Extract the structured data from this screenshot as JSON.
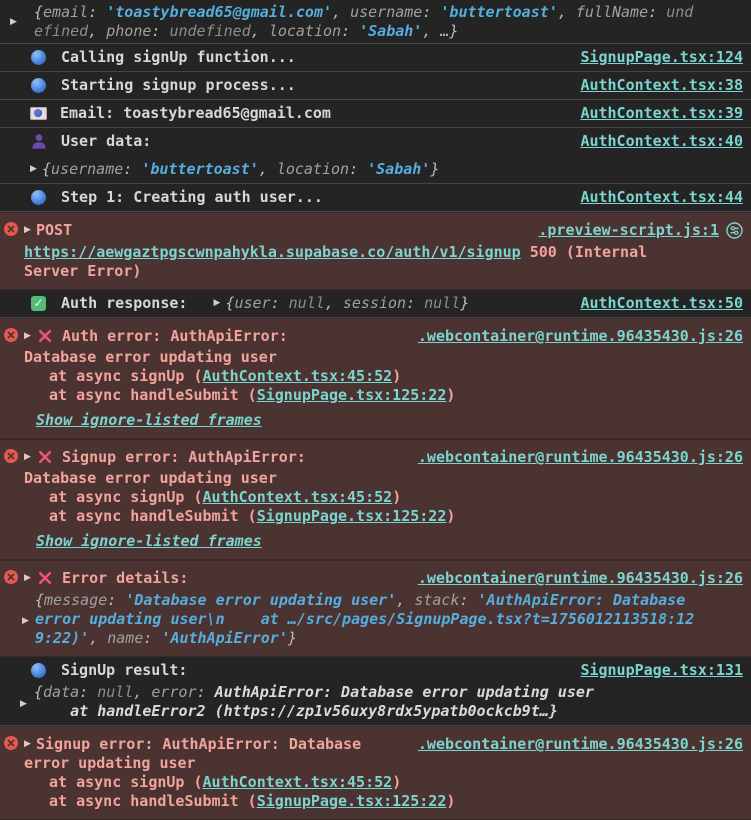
{
  "colors": {
    "background": "#242424",
    "error_background": "#4b3332",
    "error_text": "#f2a39c",
    "link_teal": "#7cd4ce",
    "string_value": "#55aedd",
    "log_text": "#d7d7d7",
    "error_badge_red": "#e5594e"
  },
  "console": {
    "rows": [
      {
        "name": "user-data-object-preview",
        "kind": "log",
        "expander": "▶",
        "lines": [
          {
            "parts": [
              {
                "t": "{",
                "s": "p"
              },
              {
                "t": "email",
                "s": "k"
              },
              {
                "t": ": ",
                "s": "p"
              },
              {
                "t": "'toastybread65@gmail.com'",
                "s": "str"
              },
              {
                "t": ", ",
                "s": "p"
              },
              {
                "t": "username",
                "s": "k"
              },
              {
                "t": ": ",
                "s": "p"
              },
              {
                "t": "'buttertoast'",
                "s": "str"
              },
              {
                "t": ", ",
                "s": "p"
              },
              {
                "t": "fullName",
                "s": "k"
              },
              {
                "t": ": ",
                "s": "p"
              },
              {
                "t": "und",
                "s": "und"
              }
            ]
          },
          {
            "parts": [
              {
                "t": "efined",
                "s": "und"
              },
              {
                "t": ", ",
                "s": "p"
              },
              {
                "t": "phone",
                "s": "k"
              },
              {
                "t": ": ",
                "s": "p"
              },
              {
                "t": "undefined",
                "s": "und"
              },
              {
                "t": ", ",
                "s": "p"
              },
              {
                "t": "location",
                "s": "k"
              },
              {
                "t": ": ",
                "s": "p"
              },
              {
                "t": "'Sabah'",
                "s": "str"
              },
              {
                "t": ", …}",
                "s": "p"
              }
            ]
          }
        ]
      },
      {
        "name": "calling-signup",
        "kind": "log",
        "icon": "blue-circle-icon",
        "message": "Calling signUp function...",
        "source": "SignupPage.tsx:124"
      },
      {
        "name": "starting-signup",
        "kind": "log",
        "icon": "blue-circle-icon",
        "message": "Starting signup process...",
        "source": "AuthContext.tsx:38"
      },
      {
        "name": "email-log",
        "kind": "log",
        "icon": "email-icon",
        "message": "Email: toastybread65@gmail.com",
        "source": "AuthContext.tsx:39"
      },
      {
        "name": "user-data-log",
        "kind": "log",
        "icon": "user-icon",
        "message": "User data:",
        "source": "AuthContext.tsx:40",
        "expander": "▶",
        "preview": [
          {
            "t": "{",
            "s": "p"
          },
          {
            "t": "username",
            "s": "k"
          },
          {
            "t": ": ",
            "s": "p"
          },
          {
            "t": "'buttertoast'",
            "s": "str"
          },
          {
            "t": ", ",
            "s": "p"
          },
          {
            "t": "location",
            "s": "k"
          },
          {
            "t": ": ",
            "s": "p"
          },
          {
            "t": "'Sabah'",
            "s": "str"
          },
          {
            "t": "}",
            "s": "p"
          }
        ]
      },
      {
        "name": "step1-creating-auth-user",
        "kind": "log",
        "icon": "blue-circle-icon",
        "message": "Step 1: Creating auth user...",
        "source": "AuthContext.tsx:44"
      },
      {
        "name": "post-500-network-error",
        "kind": "error",
        "expander": "▶",
        "title": "POST",
        "source": ".preview-script.js:1",
        "source_icon": "tune-icon",
        "lines": [
          {
            "parts": [
              {
                "t": "https://aewgaztpgscwnpahykla.supabase.co/auth/v1/signup",
                "s": "link"
              },
              {
                "t": " 500 (Internal",
                "s": "err"
              }
            ]
          },
          {
            "parts": [
              {
                "t": "Server Error)",
                "s": "err"
              }
            ]
          }
        ]
      },
      {
        "name": "auth-response",
        "kind": "log",
        "icon": "check-icon",
        "message": "Auth response:",
        "source": "AuthContext.tsx:50",
        "expander": "▶",
        "check_glyph": "✓",
        "preview": [
          {
            "t": "{",
            "s": "p"
          },
          {
            "t": "user",
            "s": "k"
          },
          {
            "t": ": ",
            "s": "p"
          },
          {
            "t": "null",
            "s": "und"
          },
          {
            "t": ", ",
            "s": "p"
          },
          {
            "t": "session",
            "s": "k"
          },
          {
            "t": ": ",
            "s": "p"
          },
          {
            "t": "null",
            "s": "und"
          },
          {
            "t": "}",
            "s": "p"
          }
        ]
      },
      {
        "name": "auth-error",
        "kind": "error",
        "expander": "▶",
        "xmark": "red-x-icon",
        "title": "Auth error: AuthApiError:",
        "source": ".webcontainer@runtime.96435430.js:26",
        "lines": [
          {
            "parts": [
              {
                "t": "Database error updating user",
                "s": "err"
              }
            ]
          },
          {
            "parts": [
              {
                "t": "at async signUp (",
                "s": "err"
              },
              {
                "t": "AuthContext.tsx:45:52",
                "s": "link"
              },
              {
                "t": ")",
                "s": "err"
              }
            ]
          },
          {
            "parts": [
              {
                "t": "at async handleSubmit (",
                "s": "err"
              },
              {
                "t": "SignupPage.tsx:125:22",
                "s": "link"
              },
              {
                "t": ")",
                "s": "err"
              }
            ]
          }
        ],
        "footer": "Show ignore-listed frames"
      },
      {
        "name": "signup-error",
        "kind": "error",
        "expander": "▶",
        "xmark": "red-x-icon",
        "title": "Signup error: AuthApiError:",
        "source": ".webcontainer@runtime.96435430.js:26",
        "lines": [
          {
            "parts": [
              {
                "t": "Database error updating user",
                "s": "err"
              }
            ]
          },
          {
            "parts": [
              {
                "t": "at async signUp (",
                "s": "err"
              },
              {
                "t": "AuthContext.tsx:45:52",
                "s": "link"
              },
              {
                "t": ")",
                "s": "err"
              }
            ]
          },
          {
            "parts": [
              {
                "t": "at async handleSubmit (",
                "s": "err"
              },
              {
                "t": "SignupPage.tsx:125:22",
                "s": "link"
              },
              {
                "t": ")",
                "s": "err"
              }
            ]
          }
        ],
        "footer": "Show ignore-listed frames"
      },
      {
        "name": "error-details",
        "kind": "error",
        "expander": "▶",
        "xmark": "red-x-icon",
        "title": "Error details:",
        "source": ".webcontainer@runtime.96435430.js:26",
        "preview_expander": "▶",
        "preview_lines": [
          {
            "parts": [
              {
                "t": "{",
                "s": "p"
              },
              {
                "t": "message",
                "s": "k"
              },
              {
                "t": ": ",
                "s": "p"
              },
              {
                "t": "'Database error updating user'",
                "s": "str"
              },
              {
                "t": ", ",
                "s": "p"
              },
              {
                "t": "stack",
                "s": "k"
              },
              {
                "t": ": ",
                "s": "p"
              },
              {
                "t": "'AuthApiError: Database",
                "s": "str"
              }
            ]
          },
          {
            "parts": [
              {
                "t": "error updating user\\n    at …/src/pages/SignupPage.tsx?t=1756012113518:12",
                "s": "str"
              }
            ]
          },
          {
            "parts": [
              {
                "t": "9:22)'",
                "s": "str"
              },
              {
                "t": ", ",
                "s": "p"
              },
              {
                "t": "name",
                "s": "k"
              },
              {
                "t": ": ",
                "s": "p"
              },
              {
                "t": "'AuthApiError'",
                "s": "str"
              },
              {
                "t": "}",
                "s": "p"
              }
            ]
          }
        ]
      },
      {
        "name": "signup-result",
        "kind": "log",
        "icon": "blue-circle-icon",
        "message": "SignUp result:",
        "source": "SignupPage.tsx:131",
        "expander": "▶",
        "preview_lines": [
          {
            "parts": [
              {
                "t": "{",
                "s": "p"
              },
              {
                "t": "data",
                "s": "k"
              },
              {
                "t": ": ",
                "s": "p"
              },
              {
                "t": "null",
                "s": "und"
              },
              {
                "t": ", ",
                "s": "p"
              },
              {
                "t": "error",
                "s": "k"
              },
              {
                "t": ": ",
                "s": "p"
              },
              {
                "t": "AuthApiError: Database error updating user",
                "s": "plain"
              }
            ]
          },
          {
            "parts": [
              {
                "t": "    at handleError2 (https://zp1v56uxy8rdx5ypatb0ockcb9t…}",
                "s": "plain"
              }
            ]
          }
        ]
      },
      {
        "name": "signup-error-2",
        "kind": "error",
        "expander": "▶",
        "title": "Signup error: AuthApiError: Database ",
        "source": ".webcontainer@runtime.96435430.js:26",
        "lines": [
          {
            "parts": [
              {
                "t": "error updating user",
                "s": "err"
              }
            ]
          },
          {
            "parts": [
              {
                "t": "at async signUp (",
                "s": "err"
              },
              {
                "t": "AuthContext.tsx:45:52",
                "s": "link"
              },
              {
                "t": ")",
                "s": "err"
              }
            ]
          },
          {
            "parts": [
              {
                "t": "at async handleSubmit (",
                "s": "err"
              },
              {
                "t": "SignupPage.tsx:125:22",
                "s": "link"
              },
              {
                "t": ")",
                "s": "err"
              }
            ]
          }
        ]
      }
    ]
  }
}
